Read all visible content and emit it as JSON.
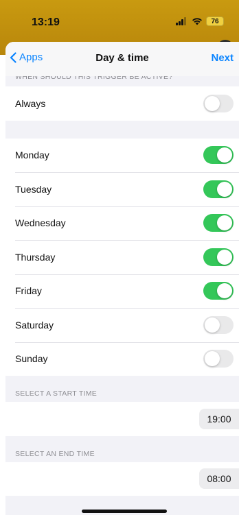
{
  "status_bar": {
    "time": "13:19",
    "battery": "76"
  },
  "navbar": {
    "back_label": "Apps",
    "title": "Day & time",
    "next_label": "Next"
  },
  "trigger": {
    "header": "WHEN SHOULD THIS TRIGGER BE ACTIVE?",
    "always_label": "Always",
    "always_on": false
  },
  "days": [
    {
      "label": "Monday",
      "on": true
    },
    {
      "label": "Tuesday",
      "on": true
    },
    {
      "label": "Wednesday",
      "on": true
    },
    {
      "label": "Thursday",
      "on": true
    },
    {
      "label": "Friday",
      "on": true
    },
    {
      "label": "Saturday",
      "on": false
    },
    {
      "label": "Sunday",
      "on": false
    }
  ],
  "start_time": {
    "header": "SELECT A START TIME",
    "value": "19:00"
  },
  "end_time": {
    "header": "SELECT AN END TIME",
    "value": "08:00"
  },
  "colors": {
    "accent": "#0a84ff",
    "toggle_on": "#34c759",
    "toggle_off": "#e9e9ea",
    "status_bg": "#c99a10"
  }
}
